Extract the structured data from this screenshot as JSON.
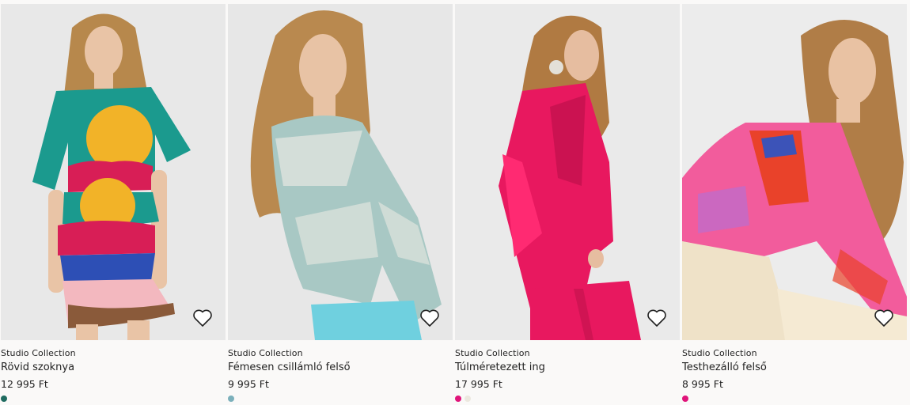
{
  "products": [
    {
      "brand": "Studio Collection",
      "name": "Rövid szoknya",
      "price": "12 995 Ft",
      "swatches": [
        "#1f6b60"
      ],
      "image": {
        "bg": "#e8e8e8",
        "hair": "#b7884c",
        "skin": "#e9c4a6",
        "garment": "#1b9a8e",
        "accent1": "#f2b328",
        "accent2": "#d81e56",
        "accent3": "#2d4fb5"
      }
    },
    {
      "brand": "Studio Collection",
      "name": "Fémesen csillámló felső",
      "price": "9 995 Ft",
      "swatches": [
        "#7bb0bb"
      ],
      "image": {
        "bg": "#e7e7e7",
        "hair": "#b9894f",
        "skin": "#e8c3a5",
        "garment": "#a8c8c4",
        "accent1": "#dfe4de",
        "accent2": "#6fd0df",
        "accent3": "#8fb7b4"
      }
    },
    {
      "brand": "Studio Collection",
      "name": "Túlméretezett ing",
      "price": "17 995 Ft",
      "swatches": [
        "#e0147a",
        "#ece8df"
      ],
      "image": {
        "bg": "#eaeaea",
        "hair": "#b07a42",
        "skin": "#e6bda0",
        "garment": "#e8185f",
        "accent1": "#ff2a72",
        "accent2": "#b80f47",
        "accent3": "#d8cbb8"
      }
    },
    {
      "brand": "Studio Collection",
      "name": "Testhezálló felső",
      "price": "8 995 Ft",
      "swatches": [
        "#e0147a"
      ],
      "image": {
        "bg": "#ececec",
        "hair": "#b07d47",
        "skin": "#e9c2a3",
        "garment": "#f25c9c",
        "accent1": "#e9422a",
        "accent2": "#3c53b8",
        "accent3": "#efe2c8"
      }
    }
  ]
}
